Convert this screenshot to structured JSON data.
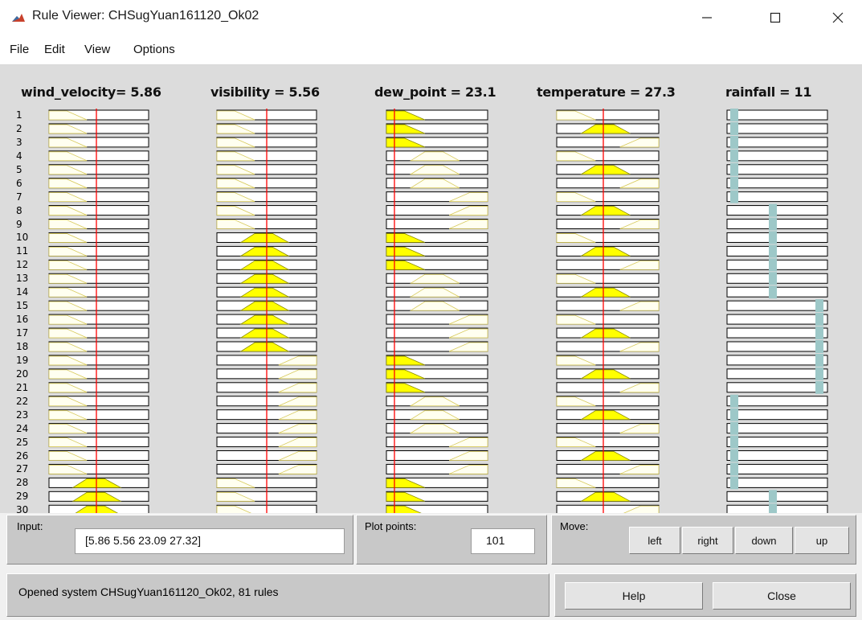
{
  "window": {
    "title": "Rule Viewer: CHSugYuan161120_Ok02",
    "minimize_icon": "minimize-icon",
    "maximize_icon": "maximize-icon",
    "close_icon": "close-icon"
  },
  "menu": [
    "File",
    "Edit",
    "View",
    "Options"
  ],
  "variables": [
    {
      "label": "wind_velocity= 5.86",
      "kind": "input"
    },
    {
      "label": "visibility = 5.56",
      "kind": "input"
    },
    {
      "label": "dew_point = 23.1",
      "kind": "input"
    },
    {
      "label": "temperature = 27.3",
      "kind": "input"
    },
    {
      "label": "rainfall = 11",
      "kind": "output"
    }
  ],
  "rule_numbers": [
    "1",
    "2",
    "3",
    "4",
    "5",
    "6",
    "7",
    "8",
    "9",
    "10",
    "11",
    "12",
    "13",
    "14",
    "15",
    "16",
    "17",
    "18",
    "19",
    "20",
    "21",
    "22",
    "23",
    "24",
    "25",
    "26",
    "27",
    "28",
    "29",
    "30"
  ],
  "rules": {
    "wind_velocity": [
      "L",
      "L",
      "L",
      "L",
      "L",
      "L",
      "L",
      "L",
      "L",
      "L",
      "L",
      "L",
      "L",
      "L",
      "L",
      "L",
      "L",
      "L",
      "L",
      "L",
      "L",
      "L",
      "L",
      "L",
      "L",
      "L",
      "L",
      "M",
      "M",
      "M"
    ],
    "visibility": [
      "L",
      "L",
      "L",
      "L",
      "L",
      "L",
      "L",
      "L",
      "L",
      "M",
      "M",
      "M",
      "M",
      "M",
      "M",
      "M",
      "M",
      "M",
      "H",
      "H",
      "H",
      "H",
      "H",
      "H",
      "H",
      "H",
      "H",
      "L",
      "L",
      "L"
    ],
    "dew_point": [
      "L",
      "L",
      "L",
      "M",
      "M",
      "M",
      "H",
      "H",
      "H",
      "L",
      "L",
      "L",
      "M",
      "M",
      "M",
      "H",
      "H",
      "H",
      "L",
      "L",
      "L",
      "M",
      "M",
      "M",
      "H",
      "H",
      "H",
      "L",
      "L",
      "L"
    ],
    "temperature": [
      "L",
      "M",
      "H",
      "L",
      "M",
      "H",
      "L",
      "M",
      "H",
      "L",
      "M",
      "H",
      "L",
      "M",
      "H",
      "L",
      "M",
      "H",
      "L",
      "M",
      "H",
      "L",
      "M",
      "H",
      "L",
      "M",
      "H",
      "L",
      "M",
      "H"
    ],
    "rainfall": [
      1,
      1,
      1,
      1,
      1,
      1,
      1,
      2,
      2,
      2,
      2,
      2,
      2,
      2,
      3,
      3,
      3,
      3,
      3,
      3,
      3,
      1,
      1,
      1,
      1,
      1,
      1,
      1,
      2,
      2
    ]
  },
  "colors": {
    "fired": "#ffff00",
    "membership_outline": "#d7c95a",
    "faint_fill": "#fffff0",
    "marker_line": "#ff0000",
    "output_bar": "#9dc8c8"
  },
  "bottom": {
    "input_label": "Input:",
    "input_value": "[5.86 5.56 23.09 27.32]",
    "plot_points_label": "Plot points:",
    "plot_points_value": "101",
    "move_label": "Move:",
    "move_buttons": [
      "left",
      "right",
      "down",
      "up"
    ],
    "status": "Opened system CHSugYuan161120_Ok02, 81 rules",
    "help_button": "Help",
    "close_button": "Close"
  }
}
